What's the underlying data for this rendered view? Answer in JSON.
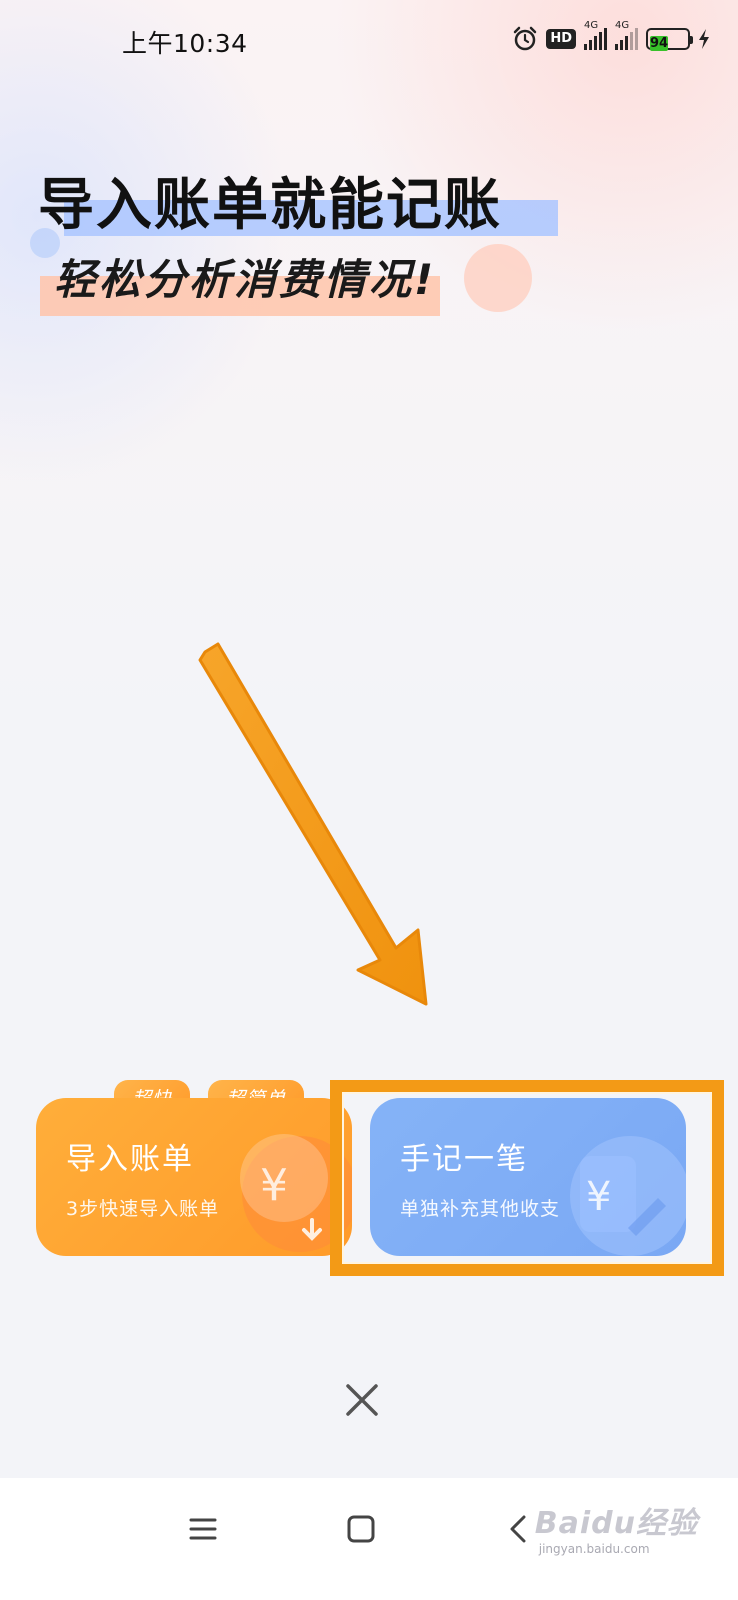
{
  "status_bar": {
    "time": "上午10:34",
    "hd_label": "HD",
    "signal1_tag": "4G",
    "signal2_tag": "4G",
    "battery_level": "94"
  },
  "headline": {
    "line1": "导入账单就能记账",
    "line2": "轻松分析消费情况!"
  },
  "tags": [
    "超快",
    "超简单"
  ],
  "cards": {
    "import": {
      "title": "导入账单",
      "subtitle": "3步快速导入账单",
      "color": "#ffa533"
    },
    "manual": {
      "title": "手记一笔",
      "subtitle": "单独补充其他收支",
      "color": "#80aef6"
    }
  },
  "annotation": {
    "arrow_color": "#f39a16",
    "highlight_color": "#f39a16"
  },
  "watermark": {
    "main": "Baidu经验",
    "url": "jingyan.baidu.com"
  }
}
